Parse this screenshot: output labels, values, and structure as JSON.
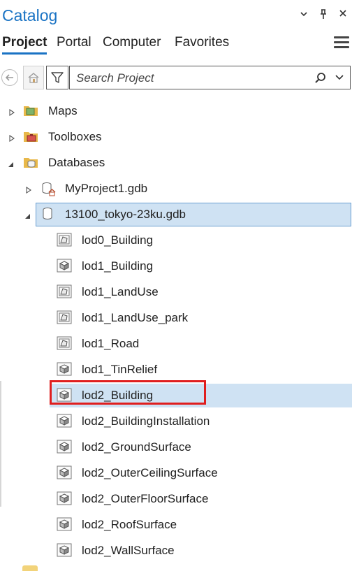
{
  "panel": {
    "title": "Catalog"
  },
  "tabs": [
    {
      "label": "Project",
      "active": true
    },
    {
      "label": "Portal",
      "active": false
    },
    {
      "label": "Computer",
      "active": false
    },
    {
      "label": "Favorites",
      "active": false
    }
  ],
  "search": {
    "placeholder": "Search Project"
  },
  "tree": {
    "maps": "Maps",
    "toolboxes": "Toolboxes",
    "databases": "Databases",
    "gdb1": "MyProject1.gdb",
    "gdb2": "13100_tokyo-23ku.gdb",
    "items": [
      {
        "label": "lod0_Building",
        "icon": "polygon-feature-class-icon"
      },
      {
        "label": "lod1_Building",
        "icon": "multipatch-feature-class-icon"
      },
      {
        "label": "lod1_LandUse",
        "icon": "polygon-feature-class-icon"
      },
      {
        "label": "lod1_LandUse_park",
        "icon": "polygon-feature-class-icon"
      },
      {
        "label": "lod1_Road",
        "icon": "polygon-feature-class-icon"
      },
      {
        "label": "lod1_TinRelief",
        "icon": "multipatch-feature-class-icon"
      },
      {
        "label": "lod2_Building",
        "icon": "multipatch-feature-class-icon",
        "selected": true
      },
      {
        "label": "lod2_BuildingInstallation",
        "icon": "multipatch-feature-class-icon"
      },
      {
        "label": "lod2_GroundSurface",
        "icon": "multipatch-feature-class-icon"
      },
      {
        "label": "lod2_OuterCeilingSurface",
        "icon": "multipatch-feature-class-icon"
      },
      {
        "label": "lod2_OuterFloorSurface",
        "icon": "multipatch-feature-class-icon"
      },
      {
        "label": "lod2_RoofSurface",
        "icon": "multipatch-feature-class-icon"
      },
      {
        "label": "lod2_WallSurface",
        "icon": "multipatch-feature-class-icon"
      }
    ]
  },
  "colors": {
    "accent": "#1a73c4",
    "selection": "#cfe2f3",
    "highlight": "#e01e1e",
    "folder": "#e8b84a"
  }
}
